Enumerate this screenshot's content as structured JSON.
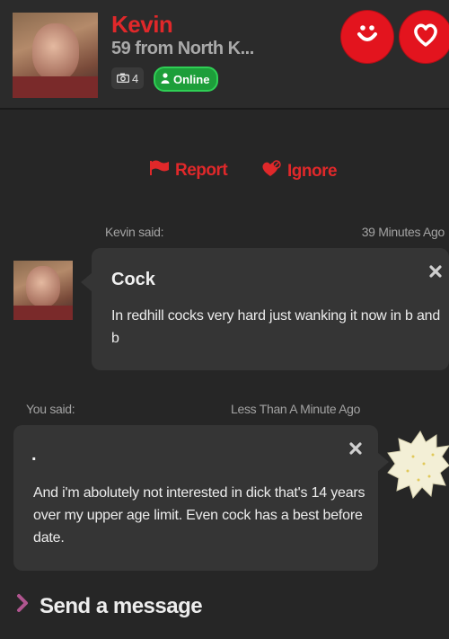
{
  "profile": {
    "name": "Kevin",
    "subtitle": "59 from North K...",
    "photo_count": "4",
    "status": "Online"
  },
  "actions": {
    "report": "Report",
    "ignore": "Ignore"
  },
  "messages": [
    {
      "said_label": "Kevin said:",
      "time": "39 Minutes Ago",
      "title": "Cock",
      "text": "In redhill cocks very hard just wanking it now in b and b"
    },
    {
      "said_label": "You said:",
      "time": "Less Than A Minute Ago",
      "title": ".",
      "text": "And i'm abolutely not interested in dick that's 14 years over my upper age limit. Even cock has a best before date."
    }
  ],
  "compose": {
    "label": "Send a message"
  },
  "icons": {
    "smile": "smile-icon",
    "heart": "heart-icon",
    "camera": "camera-icon",
    "person": "person-icon",
    "flag": "flag-icon",
    "ignore": "ignore-icon",
    "close": "close-icon",
    "chevron": "chevron-right-icon"
  },
  "colors": {
    "brand_red": "#e0282a",
    "online_green": "#1d9e3a",
    "background": "#262626",
    "bubble": "#353535",
    "chevron": "#b0558f"
  }
}
